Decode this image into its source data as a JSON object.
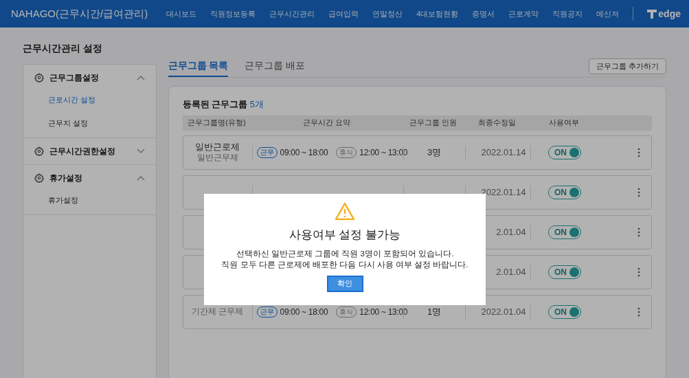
{
  "header": {
    "title": "NAHAGO(근무시간/급여관리)",
    "nav": [
      {
        "label": "대시보드",
        "selected": false
      },
      {
        "label": "직원정보등록",
        "selected": false
      },
      {
        "label": "근무시간관리",
        "selected": false
      },
      {
        "label": "급여입력",
        "selected": false
      },
      {
        "label": "연말정산",
        "selected": false
      },
      {
        "label": "4대보험현황",
        "selected": false
      },
      {
        "label": "증명서",
        "selected": false
      },
      {
        "label": "근로계약",
        "selected": false
      },
      {
        "label": "직원공지",
        "selected": false
      },
      {
        "label": "메신저",
        "selected": false
      }
    ],
    "logo": "edge"
  },
  "page_title": "근무시간관리 설정",
  "sidebar": {
    "sections": [
      {
        "label": "근무그룹설정",
        "expanded": true,
        "children": [
          {
            "label": "근로시간 설정",
            "selected": true
          },
          {
            "label": "근무지 설정",
            "selected": false
          }
        ]
      },
      {
        "label": "근무시간권한설정",
        "expanded": false
      },
      {
        "label": "휴가설정",
        "expanded": true,
        "children": [
          {
            "label": "휴가설정",
            "selected": false
          }
        ]
      }
    ]
  },
  "tabs": [
    {
      "label": "근무그룹 목록",
      "selected": true
    },
    {
      "label": "근무그룹 배포",
      "selected": false
    }
  ],
  "add_button": "근무그룹 추가하기",
  "list": {
    "heading": "등록된 근무그룹",
    "count": "5개",
    "columns": [
      "근무그룹명(유형)",
      "근무시간 요약",
      "근무그룹 인원",
      "최종수정일",
      "사용여부"
    ],
    "rows": [
      {
        "name": "일반근로제",
        "type": "일반근무제",
        "work_badge": "근무",
        "work_time": "09:00 ~ 18:00",
        "break_badge": "휴식",
        "break_time": "12:00 ~ 13:00",
        "members": "3명",
        "date": "2022.01.14",
        "toggle": "ON",
        "on": true
      },
      {
        "date": "2022.01.14",
        "toggle": "ON",
        "on": true
      },
      {
        "date": "2.01.04",
        "toggle": "ON",
        "on": true
      },
      {
        "date": "2.01.04",
        "toggle": "ON",
        "on": true
      },
      {
        "type": "기간제 근무제",
        "work_badge": "근무",
        "work_time": "09:00 ~ 18:00",
        "break_badge": "휴식",
        "break_time": "12:00 ~ 13:00",
        "members": "1명",
        "date": "2022.01.04",
        "toggle": "ON",
        "on": true
      }
    ]
  },
  "dialog": {
    "title": "사용여부 설정 불가능",
    "message": "선택하신 일반근로제 그룹에 직원 3명이 포함되어 있습니다.\n직원 모두 다른 근로제에 배포한 다음 다시 사용 여부 설정 바랍니다.",
    "button": "확인"
  }
}
